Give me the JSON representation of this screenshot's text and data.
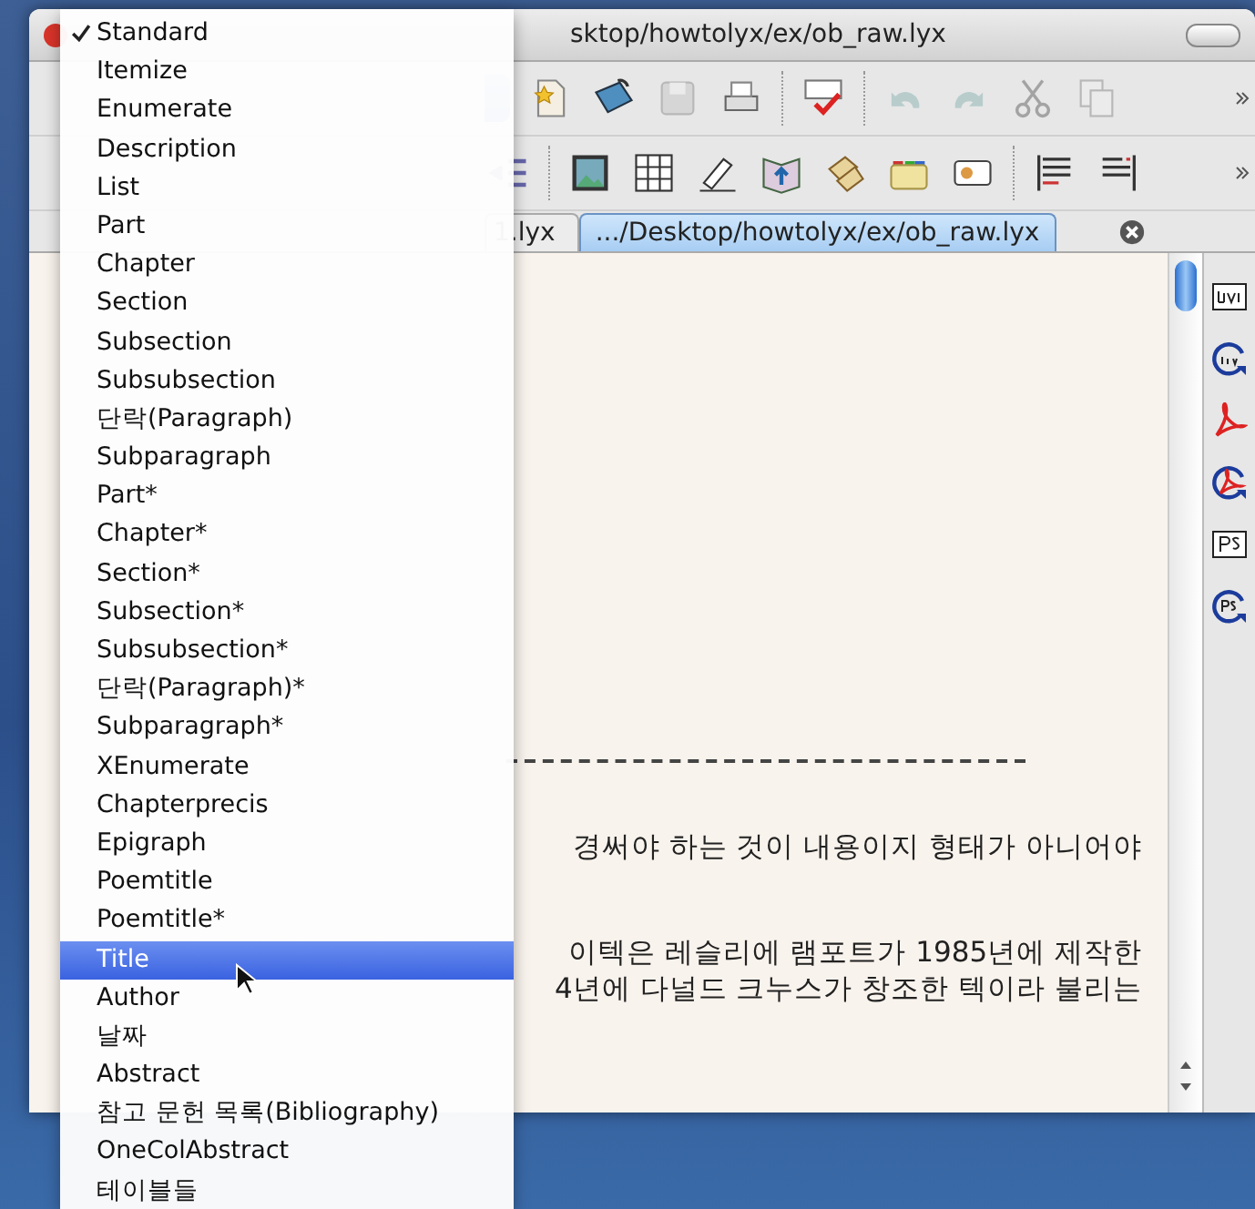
{
  "window": {
    "title": "sktop/howtolyx/ex/ob_raw.lyx"
  },
  "tabs": [
    {
      "label": "1.lyx",
      "selected": false
    },
    {
      "label": ".../Desktop/howtolyx/ex/ob_raw.lyx",
      "selected": true
    }
  ],
  "document": {
    "lines": [
      "경써야 하는 것이 내용이지 형태가 아니어야",
      "이텍은 레슬리에 램포트가 1985년에 제작한",
      "4년에 다널드 크누스가 창조한 텍이라 불리는"
    ]
  },
  "layout_menu": {
    "items": [
      {
        "label": "Standard",
        "checked": true,
        "selected": false
      },
      {
        "label": "Itemize",
        "checked": false,
        "selected": false
      },
      {
        "label": "Enumerate",
        "checked": false,
        "selected": false
      },
      {
        "label": "Description",
        "checked": false,
        "selected": false
      },
      {
        "label": "List",
        "checked": false,
        "selected": false
      },
      {
        "label": "Part",
        "checked": false,
        "selected": false
      },
      {
        "label": "Chapter",
        "checked": false,
        "selected": false
      },
      {
        "label": "Section",
        "checked": false,
        "selected": false
      },
      {
        "label": "Subsection",
        "checked": false,
        "selected": false
      },
      {
        "label": "Subsubsection",
        "checked": false,
        "selected": false
      },
      {
        "label": "단락(Paragraph)",
        "checked": false,
        "selected": false
      },
      {
        "label": "Subparagraph",
        "checked": false,
        "selected": false
      },
      {
        "label": "Part*",
        "checked": false,
        "selected": false
      },
      {
        "label": "Chapter*",
        "checked": false,
        "selected": false
      },
      {
        "label": "Section*",
        "checked": false,
        "selected": false
      },
      {
        "label": "Subsection*",
        "checked": false,
        "selected": false
      },
      {
        "label": "Subsubsection*",
        "checked": false,
        "selected": false
      },
      {
        "label": "단락(Paragraph)*",
        "checked": false,
        "selected": false
      },
      {
        "label": "Subparagraph*",
        "checked": false,
        "selected": false
      },
      {
        "label": "XEnumerate",
        "checked": false,
        "selected": false
      },
      {
        "label": "Chapterprecis",
        "checked": false,
        "selected": false
      },
      {
        "label": "Epigraph",
        "checked": false,
        "selected": false
      },
      {
        "label": "Poemtitle",
        "checked": false,
        "selected": false
      },
      {
        "label": "Poemtitle*",
        "checked": false,
        "selected": false
      },
      {
        "label": "Title",
        "checked": false,
        "selected": true
      },
      {
        "label": "Author",
        "checked": false,
        "selected": false
      },
      {
        "label": "날짜",
        "checked": false,
        "selected": false
      },
      {
        "label": "Abstract",
        "checked": false,
        "selected": false
      },
      {
        "label": "참고 문헌 목록(Bibliography)",
        "checked": false,
        "selected": false
      },
      {
        "label": "OneColAbstract",
        "checked": false,
        "selected": false
      },
      {
        "label": "테이블들",
        "checked": false,
        "selected": false
      }
    ]
  }
}
